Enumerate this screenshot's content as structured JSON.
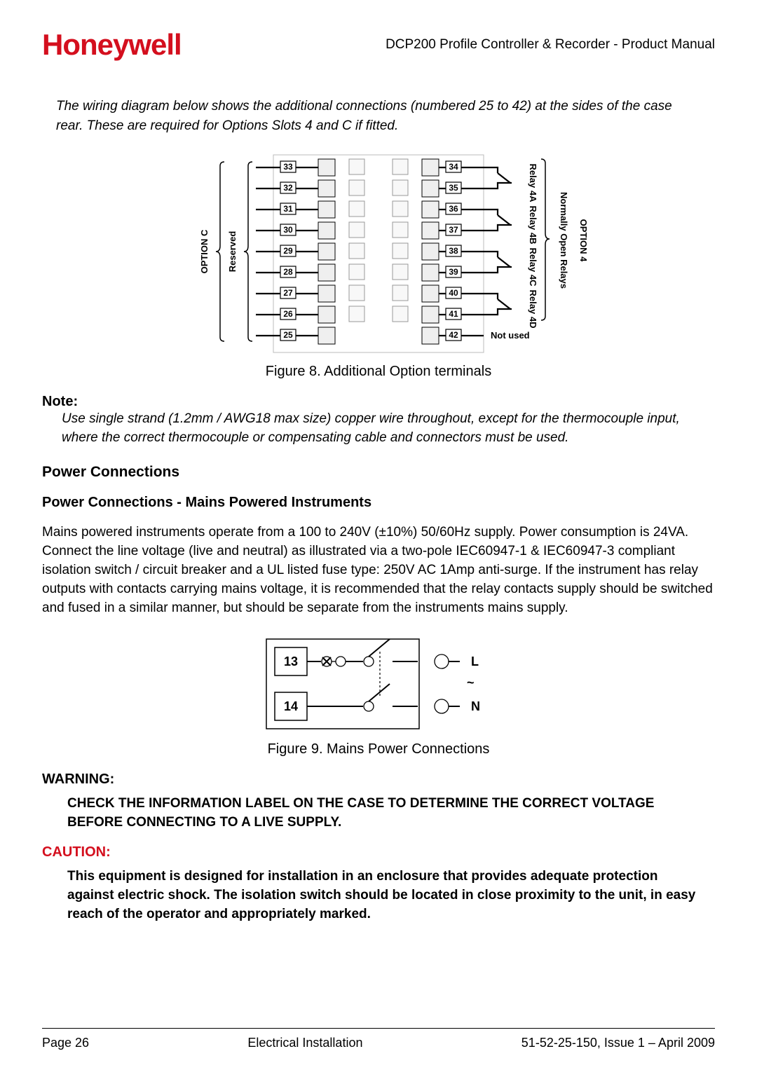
{
  "header": {
    "logo": "Honeywell",
    "doc_title": "DCP200 Profile Controller & Recorder - Product Manual"
  },
  "intro": "The wiring diagram below shows the additional connections (numbered 25 to 42) at the sides of the case rear. These are required for Options Slots 4 and C if fitted.",
  "figure8": {
    "caption": "Figure 8.  Additional Option terminals",
    "left_label": "OPTION C",
    "reserved": "Reserved",
    "right_label": "OPTION 4",
    "noro": "Normally Open Relays",
    "not_used": "Not used",
    "relays": [
      "Relay 4A",
      "Relay 4B",
      "Relay 4C",
      "Relay 4D"
    ],
    "left_nums": [
      "33",
      "32",
      "31",
      "30",
      "29",
      "28",
      "27",
      "26",
      "25"
    ],
    "right_nums": [
      "34",
      "35",
      "36",
      "37",
      "38",
      "39",
      "40",
      "41",
      "42"
    ]
  },
  "note": {
    "label": "Note:",
    "body": "Use single strand (1.2mm / AWG18 max size) copper wire throughout, except for the thermocouple input, where the correct thermocouple or compensating cable and connectors must be used."
  },
  "power": {
    "h1": "Power Connections",
    "h2": "Power Connections - Mains Powered Instruments",
    "para": "Mains powered instruments operate from a 100 to 240V (±10%) 50/60Hz supply.  Power consumption is 24VA. Connect the line voltage (live and neutral) as illustrated via a two-pole IEC60947-1 & IEC60947-3 compliant isolation switch / circuit breaker and a UL listed fuse type: 250V AC 1Amp anti-surge. If the instrument has relay outputs with contacts carrying mains voltage, it is recommended that the relay contacts supply should be switched and fused in a similar manner, but should be separate from the instruments mains supply."
  },
  "figure9": {
    "caption": "Figure 9.  Mains Power Connections",
    "t13": "13",
    "t14": "14",
    "L": "L",
    "N": "N",
    "tilde": "~"
  },
  "warning": {
    "label": "WARNING:",
    "body": "CHECK THE INFORMATION LABEL ON THE CASE TO DETERMINE THE CORRECT VOLTAGE BEFORE CONNECTING TO A LIVE SUPPLY."
  },
  "caution": {
    "label": "CAUTION:",
    "body": "This equipment is designed for installation in an enclosure that provides adequate protection against electric shock. The isolation switch should be located in close proximity to the unit, in easy reach of the operator and appropriately marked."
  },
  "footer": {
    "left": "Page 26",
    "center": "Electrical Installation",
    "right": "51-52-25-150, Issue 1 – April 2009"
  }
}
